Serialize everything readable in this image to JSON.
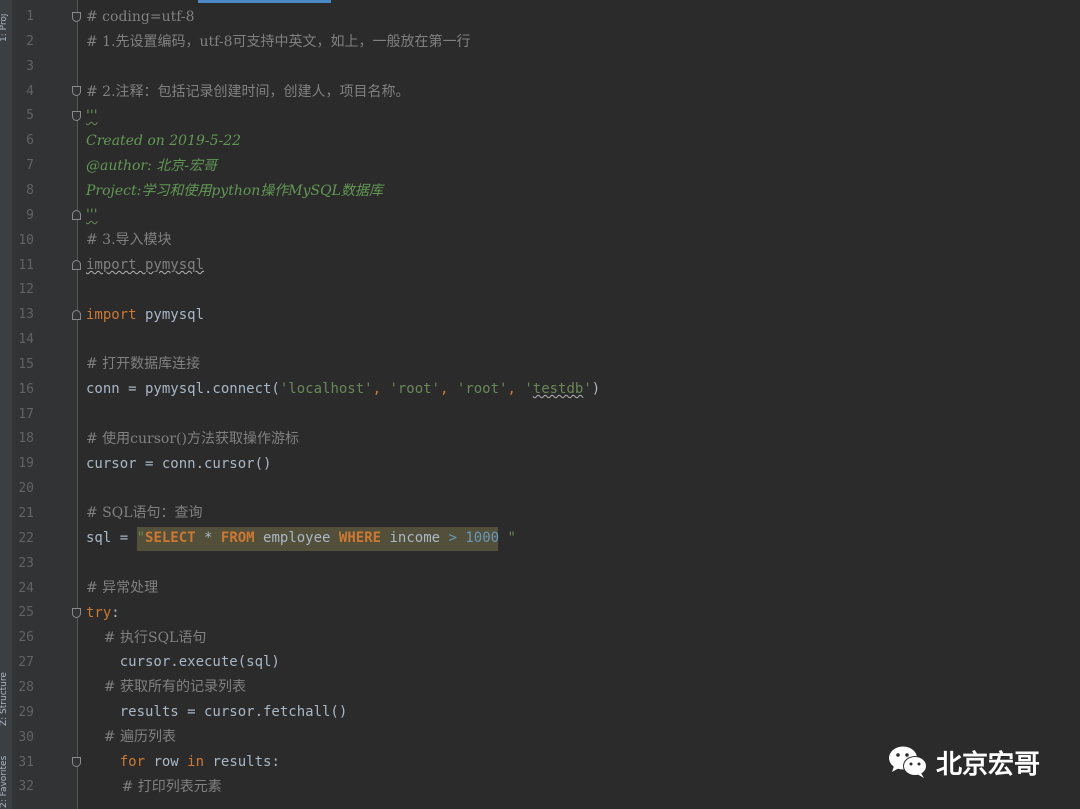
{
  "tool_strip": {
    "top_label": "1: Proj",
    "mid_label": "Z: Structure",
    "bottom_label": "2: Favorites"
  },
  "editor": {
    "line_numbers": [
      "1",
      "2",
      "3",
      "4",
      "5",
      "6",
      "7",
      "8",
      "9",
      "10",
      "11",
      "12",
      "13",
      "14",
      "15",
      "16",
      "17",
      "18",
      "19",
      "20",
      "21",
      "22",
      "23",
      "24",
      "25",
      "26",
      "27",
      "28",
      "29",
      "30",
      "31",
      "32"
    ],
    "lines": {
      "l1": "# coding=utf-8",
      "l2": "# 1.先设置编码，utf-8可支持中英文，如上，一般放在第一行",
      "l4": "# 2.注释：包括记录创建时间，创建人，项目名称。",
      "l5": "'''",
      "l6": "Created on 2019-5-22",
      "l7": "@author: 北京-宏哥",
      "l8": "Project:学习和使用python操作MySQL数据库",
      "l9": "'''",
      "l10": "# 3.导入模块",
      "l11": "import pymysql",
      "l13_kw": "import",
      "l13_rest": " pymysql",
      "l15": "# 打开数据库连接",
      "l16_a": "conn = pymysql.connect(",
      "l16_s1": "'localhost'",
      "l16_c1": ", ",
      "l16_s2": "'root'",
      "l16_c2": ", ",
      "l16_s3": "'root'",
      "l16_c3": ", ",
      "l16_q1": "'",
      "l16_s4": "testdb",
      "l16_q2": "'",
      "l16_b": ")",
      "l18": "# 使用cursor()方法获取操作游标",
      "l19": "cursor = conn.cursor()",
      "l21": "# SQL语句：查询",
      "l22_a": "sql = ",
      "l22_q1": "\"",
      "l22_k1": "SELECT",
      "l22_t1": " * ",
      "l22_k2": "FROM",
      "l22_t2": " employee ",
      "l22_k3": "WHERE",
      "l22_t3": " income ",
      "l22_op": "> ",
      "l22_num": "1000",
      "l22_q2": " \"",
      "l24": "# 异常处理",
      "l25_kw": "try",
      "l25_rest": ":",
      "l26": "    # 执行SQL语句",
      "l27": "    cursor.execute(sql)",
      "l28": "    # 获取所有的记录列表",
      "l29": "    results = cursor.fetchall()",
      "l30": "    # 遍历列表",
      "l31_indent": "    ",
      "l31_kw1": "for",
      "l31_t1": " row ",
      "l31_kw2": "in",
      "l31_t2": " results:",
      "l32": "        # 打印列表元素"
    }
  },
  "watermark": {
    "icon": "wechat-icon",
    "text": "北京宏哥"
  },
  "colors": {
    "background": "#2b2b2b",
    "gutter": "#313335",
    "comment": "#808080",
    "docstring": "#629755",
    "keyword": "#cc7832",
    "string": "#6a8759",
    "number": "#6897bb",
    "text": "#a9b7c6",
    "selection": "#52503a"
  }
}
